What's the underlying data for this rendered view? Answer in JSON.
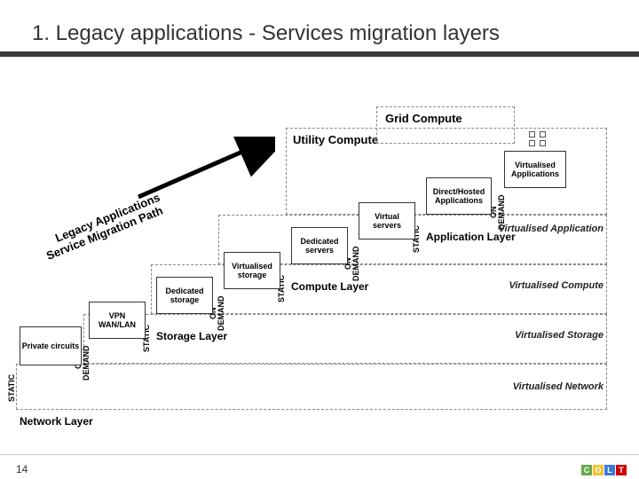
{
  "title": "1. Legacy applications - Services migration layers",
  "page_number": "14",
  "logo_letters": [
    "C",
    "O",
    "L",
    "T"
  ],
  "logo_colors": [
    "#6aa84f",
    "#f1c232",
    "#3c78d8",
    "#cc0000"
  ],
  "migration_line1": "Legacy Applications",
  "migration_line2": "Service Migration Path",
  "boxes": {
    "private_circuits": "Private circuits",
    "vpn": "VPN\nWAN/LAN",
    "ded_storage": "Dedicated\nstorage",
    "vir_storage": "Virtualised\nstorage",
    "ded_servers": "Dedicated\nservers",
    "vir_servers": "Virtual\nservers",
    "dh_apps": "Direct/Hosted\nApplications",
    "vir_apps": "Virtualised\nApplications",
    "utility": "Utility Compute",
    "grid": "Grid Compute"
  },
  "vlabels": {
    "static": "STATIC",
    "ondemand": "ON\nDEMAND"
  },
  "layers": {
    "network": "Network Layer",
    "storage": "Storage Layer",
    "compute": "Compute Layer",
    "app": "Application Layer",
    "v_network": "Virtualised Network",
    "v_storage": "Virtualised Storage",
    "v_compute": "Virtualised Compute",
    "v_app": "Virtualised Application"
  }
}
